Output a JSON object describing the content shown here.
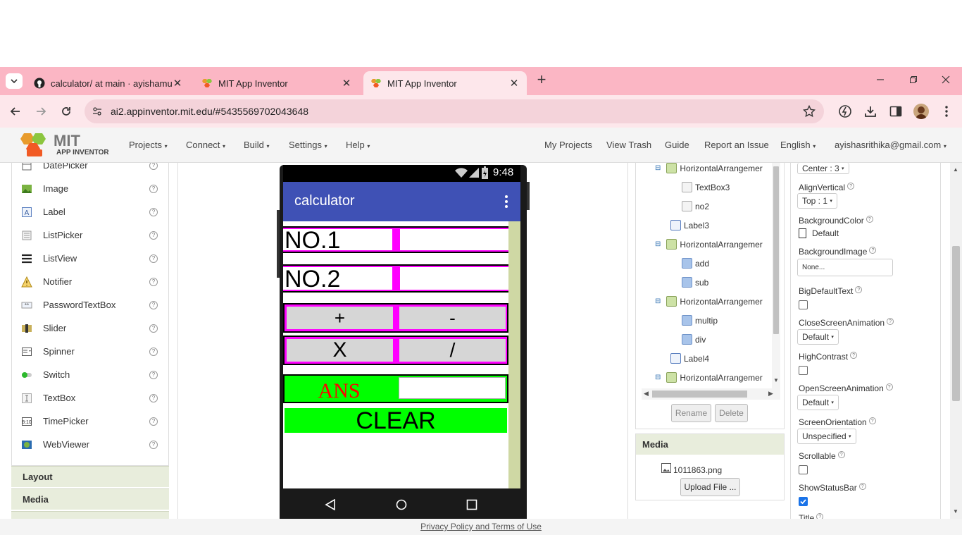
{
  "browser": {
    "tabs": [
      {
        "title": "calculator/ at main · ayishamuu",
        "icon": "github-icon"
      },
      {
        "title": "MIT App Inventor",
        "icon": "appinventor-icon"
      },
      {
        "title": "MIT App Inventor",
        "icon": "appinventor-icon",
        "active": true
      }
    ],
    "url": "ai2.appinventor.mit.edu/#5435569702043648"
  },
  "header": {
    "logo_main": "MIT",
    "logo_sub": "APP INVENTOR",
    "menus": [
      "Projects",
      "Connect",
      "Build",
      "Settings",
      "Help"
    ],
    "links": [
      "My Projects",
      "View Trash",
      "Guide",
      "Report an Issue"
    ],
    "language": "English",
    "user": "ayishasrithika@gmail.com"
  },
  "palette": {
    "items": [
      {
        "label": "DatePicker",
        "icon": "datepicker-icon"
      },
      {
        "label": "Image",
        "icon": "image-icon"
      },
      {
        "label": "Label",
        "icon": "label-icon"
      },
      {
        "label": "ListPicker",
        "icon": "listpicker-icon"
      },
      {
        "label": "ListView",
        "icon": "listview-icon"
      },
      {
        "label": "Notifier",
        "icon": "notifier-icon"
      },
      {
        "label": "PasswordTextBox",
        "icon": "password-icon"
      },
      {
        "label": "Slider",
        "icon": "slider-icon"
      },
      {
        "label": "Spinner",
        "icon": "spinner-icon"
      },
      {
        "label": "Switch",
        "icon": "switch-icon"
      },
      {
        "label": "TextBox",
        "icon": "textbox-icon"
      },
      {
        "label": "TimePicker",
        "icon": "timepicker-icon"
      },
      {
        "label": "WebViewer",
        "icon": "webviewer-icon"
      }
    ],
    "sections": [
      "Layout",
      "Media"
    ]
  },
  "phone": {
    "time": "9:48",
    "app_title": "calculator",
    "no1_label": "NO.1",
    "no2_label": "NO.2",
    "add": "+",
    "sub": "-",
    "mul": "X",
    "div": "/",
    "ans_label": "ANS",
    "clear": "CLEAR"
  },
  "components": {
    "nodes": [
      {
        "label": "HorizontalArrangemer",
        "type": "arrangement"
      },
      {
        "label": "TextBox3",
        "type": "textbox"
      },
      {
        "label": "no2",
        "type": "textbox"
      },
      {
        "label": "Label3",
        "type": "label"
      },
      {
        "label": "HorizontalArrangemer",
        "type": "arrangement"
      },
      {
        "label": "add",
        "type": "button"
      },
      {
        "label": "sub",
        "type": "button"
      },
      {
        "label": "HorizontalArrangemer",
        "type": "arrangement"
      },
      {
        "label": "multip",
        "type": "button"
      },
      {
        "label": "div",
        "type": "button"
      },
      {
        "label": "Label4",
        "type": "label"
      },
      {
        "label": "HorizontalArrangemer",
        "type": "arrangement"
      }
    ],
    "rename": "Rename",
    "delete": "Delete"
  },
  "media": {
    "title": "Media",
    "file": "1011863.png",
    "upload": "Upload File ..."
  },
  "properties": {
    "align_h_value": "Center : 3",
    "align_vertical": "AlignVertical",
    "align_vertical_value": "Top : 1",
    "background_color": "BackgroundColor",
    "background_color_value": "Default",
    "background_image": "BackgroundImage",
    "background_image_value": "None...",
    "big_default_text": "BigDefaultText",
    "close_screen_animation": "CloseScreenAnimation",
    "close_screen_animation_value": "Default",
    "high_contrast": "HighContrast",
    "open_screen_animation": "OpenScreenAnimation",
    "open_screen_animation_value": "Default",
    "screen_orientation": "ScreenOrientation",
    "screen_orientation_value": "Unspecified",
    "scrollable": "Scrollable",
    "show_status_bar": "ShowStatusBar",
    "title": "Title"
  },
  "footer": {
    "privacy": "Privacy Policy and Terms of Use"
  },
  "colors": {
    "tabbar": "#fbb6c4",
    "appbar": "#3f51b5",
    "magenta": "#ff00ff",
    "green": "#00ff00",
    "ans": "#ff0000"
  }
}
